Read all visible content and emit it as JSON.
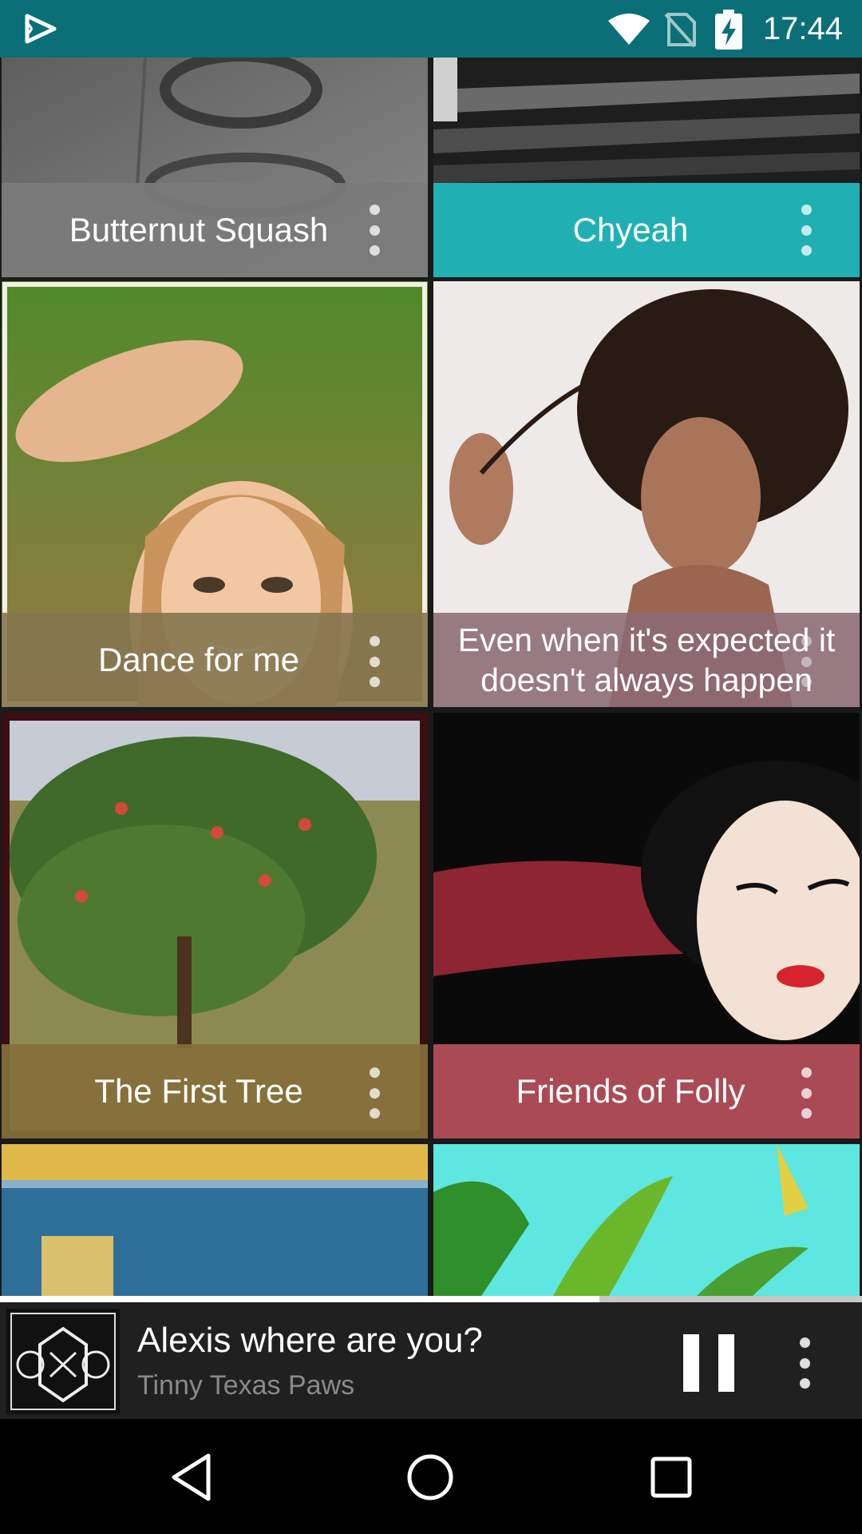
{
  "status_bar": {
    "time": "17:44",
    "background": "#0b6f77",
    "icons": [
      "play-store-icon",
      "wifi-icon",
      "no-sim-icon",
      "battery-charging-icon"
    ]
  },
  "albums": [
    {
      "title": "Butternut Squash",
      "caption_color": "#7a7a7a",
      "menu_icon": "more-vert-icon"
    },
    {
      "title": "Chyeah",
      "caption_color": "#21b8bd",
      "menu_icon": "more-vert-icon"
    },
    {
      "title": "Dance for me",
      "caption_color": "#857650",
      "menu_icon": "more-vert-icon"
    },
    {
      "title": "Even when it's expected it doesn't always happen",
      "caption_color": "#8c6a74",
      "menu_icon": "more-vert-icon"
    },
    {
      "title": "The First Tree",
      "caption_color": "#866f3b",
      "menu_icon": "more-vert-icon"
    },
    {
      "title": "Friends of Folly",
      "caption_color": "#b9505c",
      "menu_icon": "more-vert-icon"
    }
  ],
  "playback": {
    "progress": 0.695
  },
  "now_playing": {
    "song": "Alexis where are you?",
    "artist": "Tinny Texas Paws",
    "state": "playing",
    "controls": [
      "pause-icon",
      "more-vert-icon"
    ]
  },
  "nav_bar": {
    "buttons": [
      "back-icon",
      "home-icon",
      "recents-icon"
    ]
  }
}
